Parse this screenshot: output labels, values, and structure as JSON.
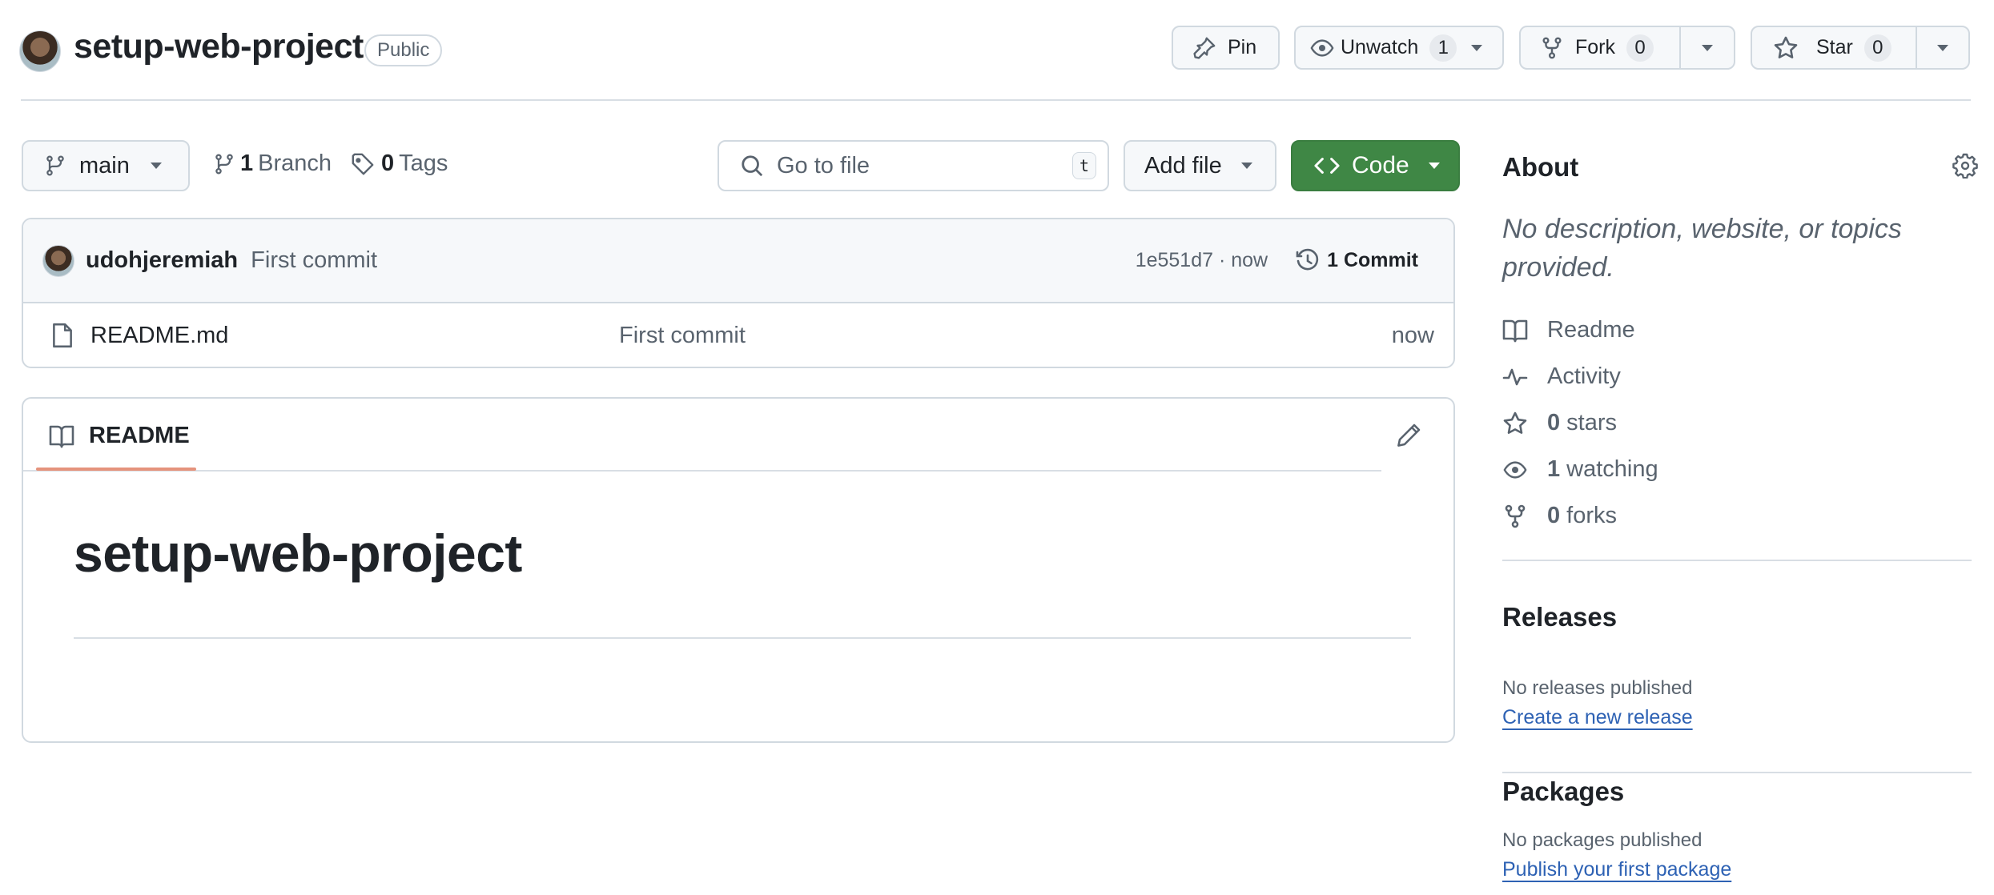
{
  "header": {
    "repo_name": "setup-web-project",
    "visibility": "Public",
    "pin_label": "Pin",
    "watch_label": "Unwatch",
    "watch_count": "1",
    "fork_label": "Fork",
    "fork_count": "0",
    "star_label": "Star",
    "star_count": "0"
  },
  "toolbar": {
    "branch": "main",
    "branches_count": "1",
    "branches_label": "Branch",
    "tags_count": "0",
    "tags_label": "Tags",
    "search_placeholder": "Go to file",
    "search_shortcut": "t",
    "add_file_label": "Add file",
    "code_label": "Code"
  },
  "latest_commit": {
    "author": "udohjeremiah",
    "message": "First commit",
    "sha_time": "1e551d7 · now",
    "commits_label": "1 Commit"
  },
  "files": [
    {
      "name": "README.md",
      "commit_message": "First commit",
      "age": "now"
    }
  ],
  "readme": {
    "tab_label": "README",
    "heading": "setup-web-project"
  },
  "sidebar": {
    "about_title": "About",
    "description": "No description, website, or topics provided.",
    "items": [
      {
        "icon": "book-icon",
        "count": "",
        "label": "Readme"
      },
      {
        "icon": "pulse-icon",
        "count": "",
        "label": "Activity"
      },
      {
        "icon": "star-icon",
        "count": "0",
        "label": "stars"
      },
      {
        "icon": "eye-icon",
        "count": "1",
        "label": "watching"
      },
      {
        "icon": "fork-icon",
        "count": "0",
        "label": "forks"
      }
    ],
    "releases": {
      "title": "Releases",
      "empty_text": "No releases published",
      "link": "Create a new release"
    },
    "packages": {
      "title": "Packages",
      "empty_text": "No packages published",
      "link": "Publish your first package"
    }
  },
  "colors": {
    "code_button": "#3f8745",
    "tab_underline": "#e5937c",
    "link": "#2e62b4"
  }
}
